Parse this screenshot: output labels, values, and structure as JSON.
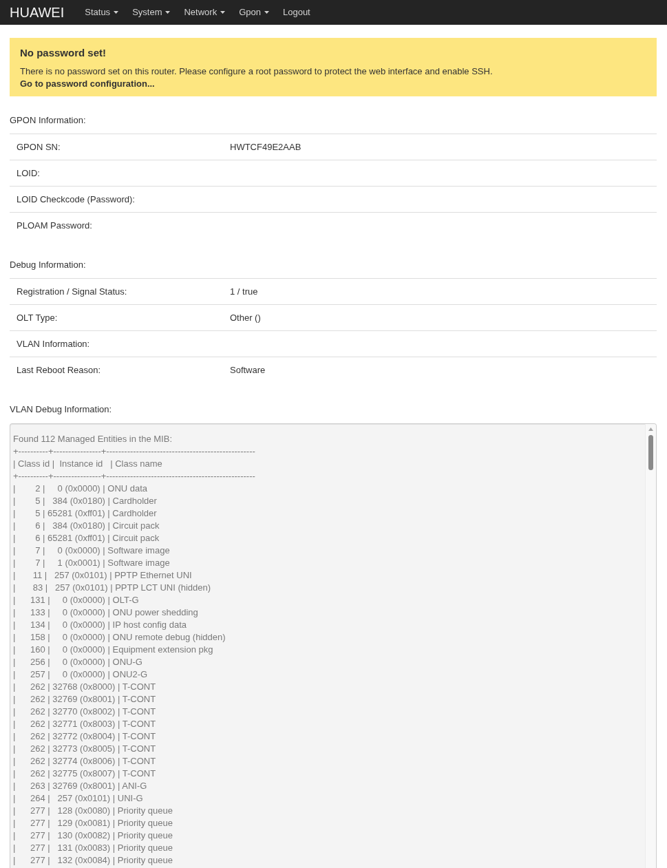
{
  "navbar": {
    "brand": "HUAWEI",
    "menu": [
      {
        "label": "Status",
        "dropdown": true
      },
      {
        "label": "System",
        "dropdown": true
      },
      {
        "label": "Network",
        "dropdown": true
      },
      {
        "label": "Gpon",
        "dropdown": true
      },
      {
        "label": "Logout",
        "dropdown": false
      }
    ]
  },
  "alert": {
    "title": "No password set!",
    "message": "There is no password set on this router. Please configure a root password to protect the web interface and enable SSH.",
    "link": "Go to password configuration..."
  },
  "sections": [
    {
      "kind": "table",
      "heading": "GPON Information:",
      "rows": [
        {
          "label": "GPON SN:",
          "value": "HWTCF49E2AAB"
        },
        {
          "label": "LOID:"
        },
        {
          "label": "LOID Checkcode (Password):"
        },
        {
          "label": "PLOAM Password:"
        }
      ]
    },
    {
      "kind": "table",
      "heading": "Debug Information:",
      "rows": [
        {
          "label": "Registration / Signal Status:",
          "value": "1 / true"
        },
        {
          "label": "OLT Type:",
          "value": "Other ()"
        },
        {
          "label": "VLAN Information:"
        },
        {
          "label": "Last Reboot Reason:",
          "value": "Software"
        }
      ]
    },
    {
      "kind": "log",
      "heading": "VLAN Debug Information:",
      "lines": [
        "Found 112 Managed Entities in the MIB:",
        "+----------+----------------+--------------------------------------------------",
        "| Class id |  Instance id   | Class name",
        "+----------+----------------+--------------------------------------------------",
        "|        2 |     0 (0x0000) | ONU data",
        "|        5 |   384 (0x0180) | Cardholder",
        "|        5 | 65281 (0xff01) | Cardholder",
        "|        6 |   384 (0x0180) | Circuit pack",
        "|        6 | 65281 (0xff01) | Circuit pack",
        "|        7 |     0 (0x0000) | Software image",
        "|        7 |     1 (0x0001) | Software image",
        "|       11 |   257 (0x0101) | PPTP Ethernet UNI",
        "|       83 |   257 (0x0101) | PPTP LCT UNI (hidden)",
        "|      131 |     0 (0x0000) | OLT-G",
        "|      133 |     0 (0x0000) | ONU power shedding",
        "|      134 |     0 (0x0000) | IP host config data",
        "|      158 |     0 (0x0000) | ONU remote debug (hidden)",
        "|      160 |     0 (0x0000) | Equipment extension pkg",
        "|      256 |     0 (0x0000) | ONU-G",
        "|      257 |     0 (0x0000) | ONU2-G",
        "|      262 | 32768 (0x8000) | T-CONT",
        "|      262 | 32769 (0x8001) | T-CONT",
        "|      262 | 32770 (0x8002) | T-CONT",
        "|      262 | 32771 (0x8003) | T-CONT",
        "|      262 | 32772 (0x8004) | T-CONT",
        "|      262 | 32773 (0x8005) | T-CONT",
        "|      262 | 32774 (0x8006) | T-CONT",
        "|      262 | 32775 (0x8007) | T-CONT",
        "|      263 | 32769 (0x8001) | ANI-G",
        "|      264 |   257 (0x0101) | UNI-G",
        "|      277 |   128 (0x0080) | Priority queue",
        "|      277 |   129 (0x0081) | Priority queue",
        "|      277 |   130 (0x0082) | Priority queue",
        "|      277 |   131 (0x0083) | Priority queue",
        "|      277 |   132 (0x0084) | Priority queue"
      ]
    }
  ]
}
